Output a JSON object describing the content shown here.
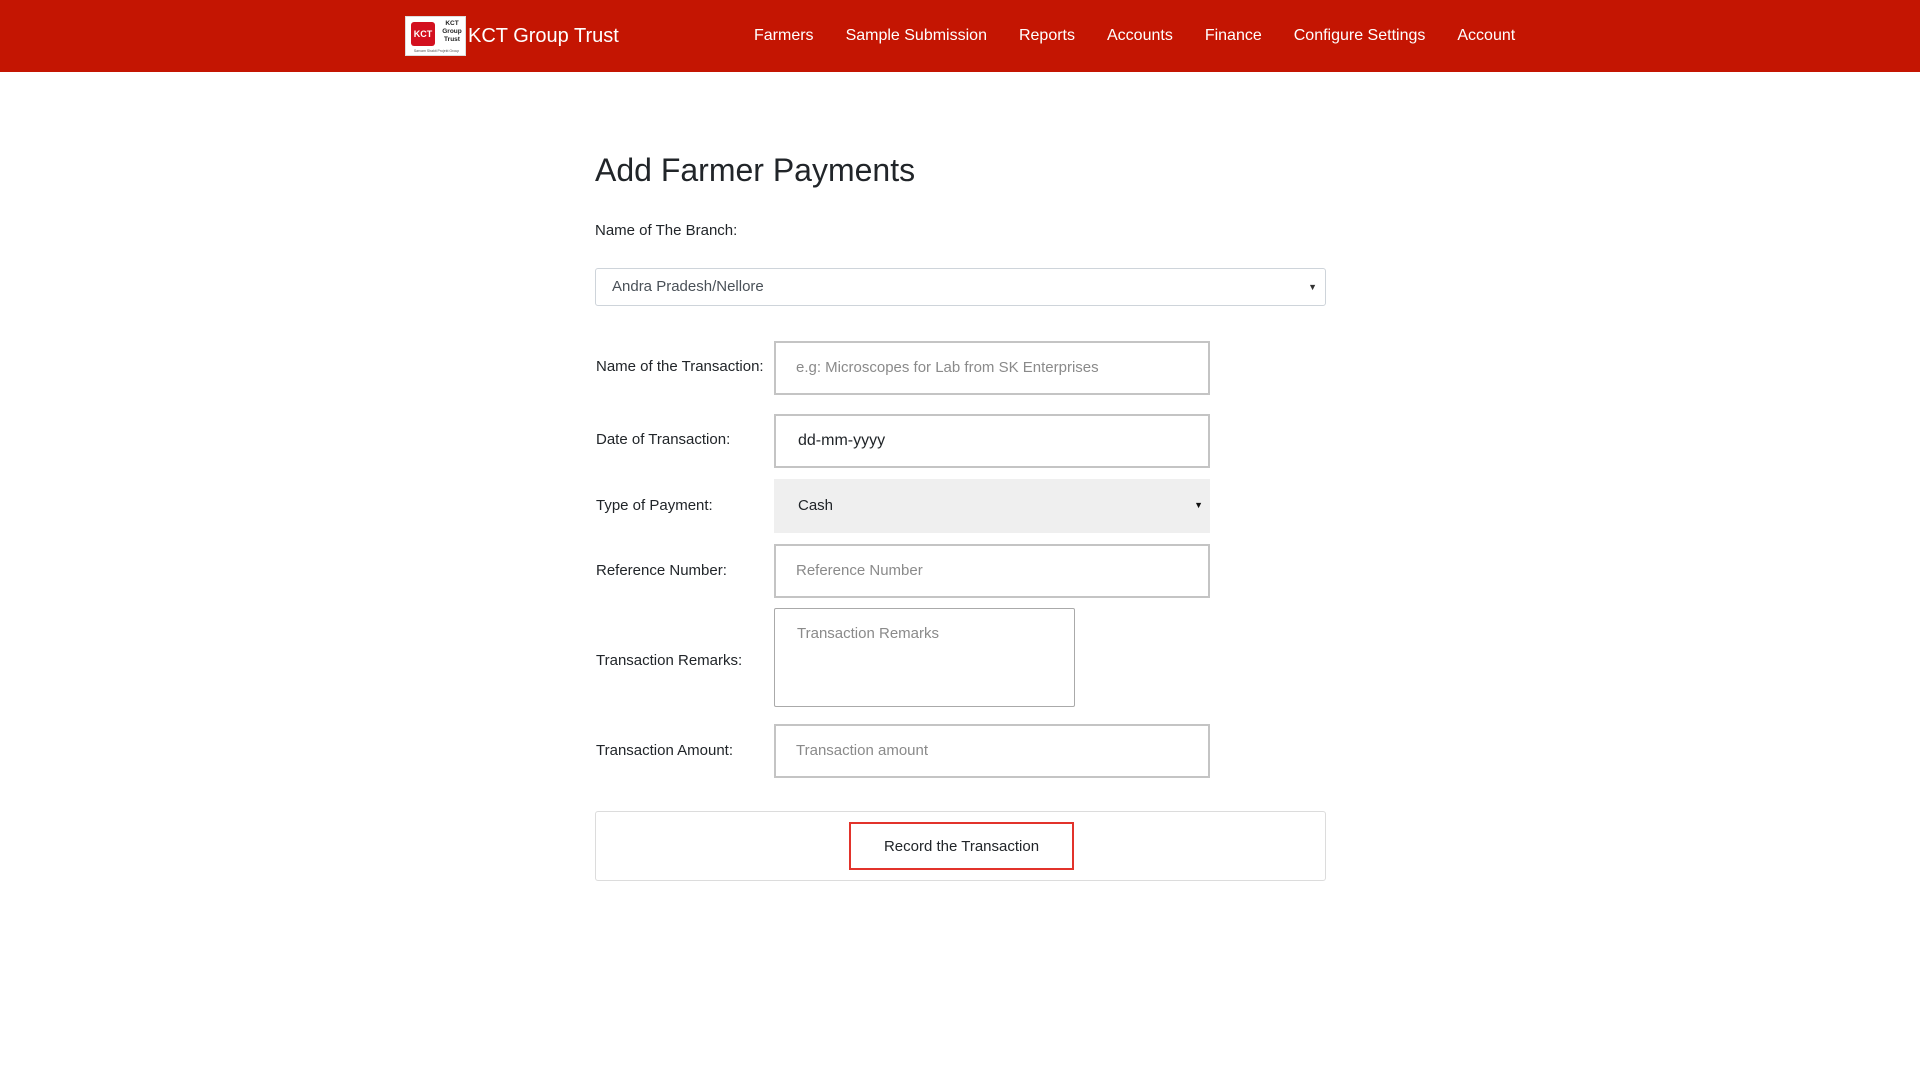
{
  "navbar": {
    "logo": {
      "mark": "KCT",
      "text": "KCT Group Trust",
      "subtext": "Sarvam Shakti Projekt Group"
    },
    "brand_name": "KCT Group Trust",
    "items": [
      {
        "label": "Farmers"
      },
      {
        "label": "Sample Submission"
      },
      {
        "label": "Reports"
      },
      {
        "label": "Accounts"
      },
      {
        "label": "Finance"
      },
      {
        "label": "Configure Settings"
      },
      {
        "label": "Account"
      }
    ]
  },
  "form": {
    "title": "Add Farmer Payments",
    "branch": {
      "label": "Name of The Branch:",
      "value": "Andra Pradesh/Nellore"
    },
    "transaction_name": {
      "label": "Name of the Transaction:",
      "placeholder": "e.g: Microscopes for Lab from SK Enterprises"
    },
    "transaction_date": {
      "label": "Date of Transaction:",
      "value": "dd-mm-yyyy"
    },
    "payment_type": {
      "label": "Type of Payment:",
      "value": "Cash"
    },
    "reference_number": {
      "label": "Reference Number:",
      "placeholder": "Reference Number"
    },
    "remarks": {
      "label": "Transaction Remarks:",
      "placeholder": "Transaction Remarks"
    },
    "amount": {
      "label": "Transaction Amount:",
      "placeholder": "Transaction amount"
    },
    "submit_label": "Record the Transaction"
  }
}
